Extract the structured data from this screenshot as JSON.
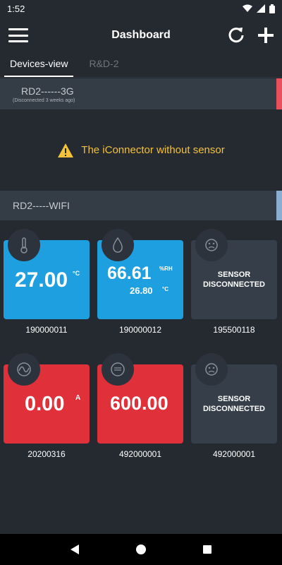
{
  "status_bar": {
    "time": "1:52"
  },
  "app_bar": {
    "title": "Dashboard"
  },
  "tabs": [
    {
      "label": "Devices-view",
      "active": true
    },
    {
      "label": "R&D-2",
      "active": false
    }
  ],
  "groups": [
    {
      "name": "RD2------3G",
      "status": "(Disconnected 3 weeks ago)",
      "marker_color": "#e8505b",
      "warning": "The iConnector without sensor"
    },
    {
      "name": "RD2-----WIFI",
      "marker_color": "#8aaed0",
      "tiles": [
        {
          "icon": "thermometer-icon",
          "color": "blue",
          "value": "27.00",
          "unit": "°C",
          "label": "190000011"
        },
        {
          "icon": "water-drop-icon",
          "color": "blue",
          "value": "66.61",
          "unit": "%RH",
          "value2": "26.80",
          "unit2": "°C",
          "label": "190000012"
        },
        {
          "icon": "sad-face-icon",
          "color": "grey",
          "status_line1": "SENSOR",
          "status_line2": "DISCONNECTED",
          "label": "195500118"
        },
        {
          "icon": "sine-wave-icon",
          "color": "red",
          "value": "0.00",
          "unit": "A",
          "label": "20200316"
        },
        {
          "icon": "gauge-lines-icon",
          "color": "red",
          "value": "600.00",
          "label": "492000001"
        },
        {
          "icon": "sad-face-icon",
          "color": "grey",
          "status_line1": "SENSOR",
          "status_line2": "DISCONNECTED",
          "label": "492000001"
        }
      ]
    }
  ]
}
